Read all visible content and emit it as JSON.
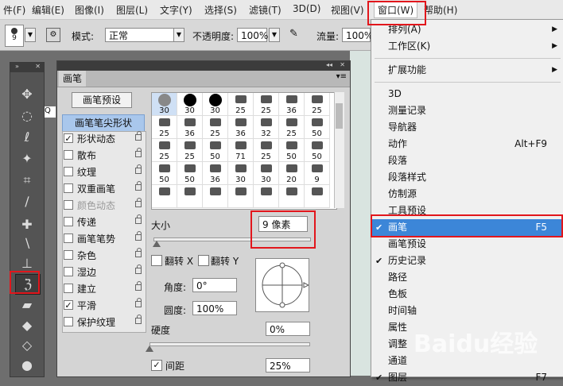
{
  "menubar": {
    "items": [
      "件(F)",
      "编辑(E)",
      "图像(I)",
      "图层(L)",
      "文字(Y)",
      "选择(S)",
      "滤镜(T)",
      "3D(D)",
      "视图(V)",
      "窗口(W)",
      "帮助(H)"
    ]
  },
  "options": {
    "brush_size": "9",
    "mode_label": "模式:",
    "mode_value": "正常",
    "opacity_label": "不透明度:",
    "opacity_value": "100%",
    "flow_label": "流量:",
    "flow_value": "100%"
  },
  "brush_panel": {
    "tab": "画笔",
    "preset_button": "画笔预设",
    "tip_shape": "画笔笔尖形状",
    "options": [
      {
        "label": "形状动态",
        "checked": true,
        "enabled": true
      },
      {
        "label": "散布",
        "checked": false,
        "enabled": true
      },
      {
        "label": "纹理",
        "checked": false,
        "enabled": true
      },
      {
        "label": "双重画笔",
        "checked": false,
        "enabled": true
      },
      {
        "label": "颜色动态",
        "checked": false,
        "enabled": false
      },
      {
        "label": "传递",
        "checked": false,
        "enabled": true
      },
      {
        "label": "画笔笔势",
        "checked": false,
        "enabled": true
      },
      {
        "label": "杂色",
        "checked": false,
        "enabled": true
      },
      {
        "label": "湿边",
        "checked": false,
        "enabled": true
      },
      {
        "label": "建立",
        "checked": false,
        "enabled": true
      },
      {
        "label": "平滑",
        "checked": true,
        "enabled": true
      },
      {
        "label": "保护纹理",
        "checked": false,
        "enabled": true
      }
    ],
    "preset_sizes": [
      [
        "30",
        "30",
        "30",
        "25",
        "25",
        "36",
        "25"
      ],
      [
        "25",
        "36",
        "25",
        "36",
        "32",
        "25",
        "50"
      ],
      [
        "25",
        "25",
        "50",
        "71",
        "25",
        "50",
        "50"
      ],
      [
        "50",
        "50",
        "36",
        "30",
        "30",
        "20",
        "9"
      ],
      [
        "",
        "",
        "",
        "",
        "",
        "",
        ""
      ]
    ],
    "size_label": "大小",
    "size_value": "9 像素",
    "flip_x": "翻转 X",
    "flip_y": "翻转 Y",
    "angle_label": "角度:",
    "angle_value": "0°",
    "roundness_label": "圆度:",
    "roundness_value": "100%",
    "hardness_label": "硬度",
    "hardness_value": "0%",
    "spacing_label": "间距",
    "spacing_value": "25%",
    "spacing_checked": true
  },
  "window_menu": {
    "items": [
      {
        "label": "排列(A)",
        "submenu": true
      },
      {
        "label": "工作区(K)",
        "submenu": true
      },
      {
        "sep": true
      },
      {
        "label": "扩展功能",
        "submenu": true
      },
      {
        "sep": true
      },
      {
        "label": "3D"
      },
      {
        "label": "测量记录"
      },
      {
        "label": "导航器"
      },
      {
        "label": "动作",
        "shortcut": "Alt+F9"
      },
      {
        "label": "段落"
      },
      {
        "label": "段落样式"
      },
      {
        "label": "仿制源"
      },
      {
        "label": "工具预设"
      },
      {
        "label": "画笔",
        "shortcut": "F5",
        "checked": true,
        "highlighted": true
      },
      {
        "label": "画笔预设"
      },
      {
        "label": "历史记录",
        "checked": true
      },
      {
        "label": "路径"
      },
      {
        "label": "色板"
      },
      {
        "label": "时间轴"
      },
      {
        "label": "属性"
      },
      {
        "label": "调整"
      },
      {
        "label": "通道"
      },
      {
        "label": "图层",
        "shortcut": "F7",
        "checked": true
      }
    ]
  },
  "watermark": "Baidu经验",
  "colors": {
    "highlight": "#3c86d8",
    "annotation": "#e2161c"
  }
}
